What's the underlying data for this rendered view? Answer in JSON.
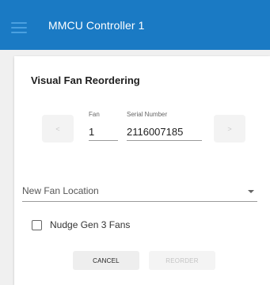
{
  "appbar": {
    "menu_icon": "hamburger-menu-icon",
    "title": "MMCU Controller 1"
  },
  "card": {
    "title": "Visual Fan Reordering",
    "nav": {
      "prev_label": "<",
      "next_label": ">"
    },
    "fan": {
      "label": "Fan",
      "value": "1"
    },
    "serial": {
      "label": "Serial Number",
      "value": "2116007185"
    },
    "new_location": {
      "placeholder": "New Fan Location",
      "caret_icon": "caret-down-icon"
    },
    "nudge": {
      "label": "Nudge Gen 3 Fans",
      "checked": false
    },
    "buttons": {
      "cancel": "CANCEL",
      "reorder": "REORDER"
    }
  },
  "colors": {
    "appbar": "#1a7ac4",
    "menu_icon": "#4aa0e0",
    "card": "#ffffff",
    "background": "#f0f0f0"
  }
}
